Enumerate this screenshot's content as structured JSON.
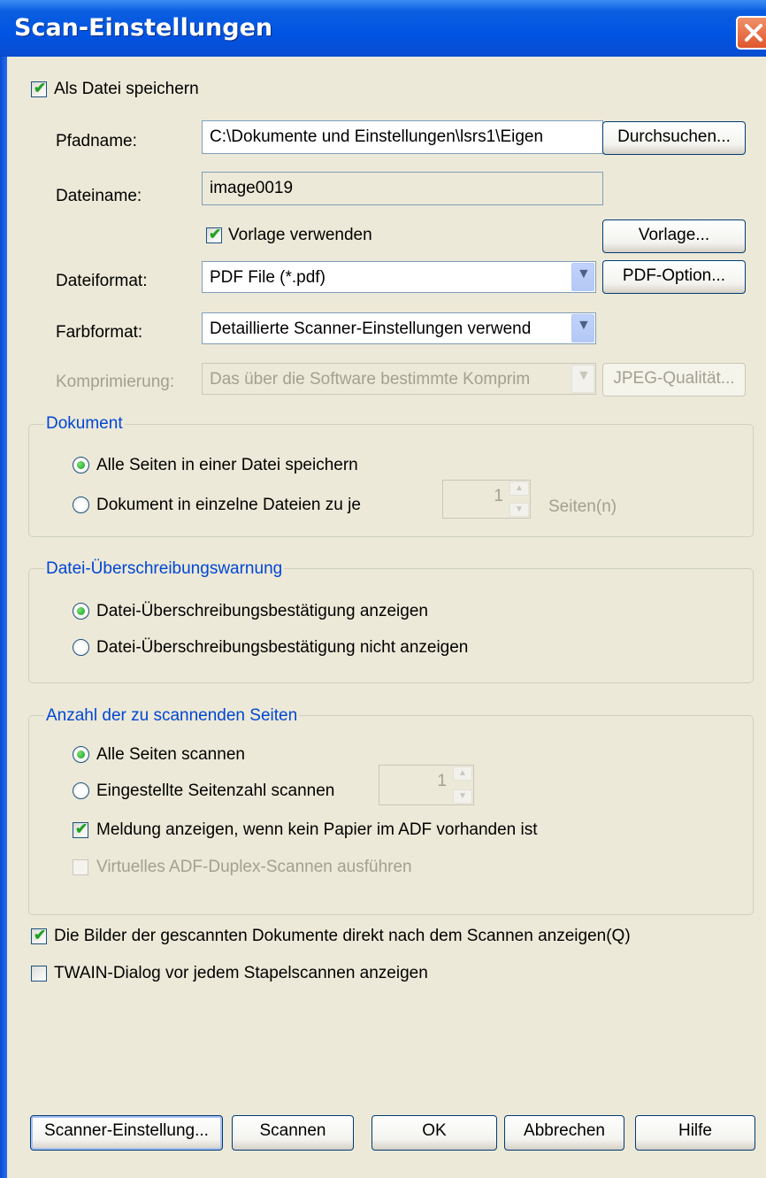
{
  "window": {
    "title": "Scan-Einstellungen",
    "close_icon": "close-icon",
    "accent": "#0054e3",
    "close_color": "#e0572e"
  },
  "save_as_file": {
    "label": "Als Datei speichern",
    "checked": true
  },
  "path": {
    "label": "Pfadname:",
    "value": "C:\\Dokumente und Einstellungen\\lsrs1\\Eigen",
    "browse_label": "Durchsuchen..."
  },
  "filename": {
    "label": "Dateiname:",
    "value": "image0019"
  },
  "template": {
    "label": "Vorlage  verwenden",
    "checked": true,
    "button_label": "Vorlage..."
  },
  "file_format": {
    "label": "Dateiformat:",
    "value": "PDF File (*.pdf)",
    "options_button": "PDF-Option..."
  },
  "color_format": {
    "label": "Farbformat:",
    "value": "Detaillierte Scanner-Einstellungen verwend"
  },
  "compression": {
    "label": "Komprimierung:",
    "value": "Das über die Software bestimmte Komprim",
    "quality_button": "JPEG-Qualität..."
  },
  "document": {
    "title": "Dokument",
    "all_pages_label": "Alle Seiten in einer Datei speichern",
    "split_label": "Dokument in einzelne Dateien zu je",
    "split_value": "1",
    "pages_unit": "Seiten(n)",
    "selected": "all_pages"
  },
  "overwrite": {
    "title": "Datei-Überschreibungswarnung",
    "show_label": "Datei-Überschreibungsbestätigung anzeigen",
    "hide_label": "Datei-Überschreibungsbestätigung nicht anzeigen",
    "selected": "show"
  },
  "page_count": {
    "title": "Anzahl der zu scannenden Seiten",
    "all_label": "Alle Seiten scannen",
    "set_label": "Eingestellte Seitenzahl scannen",
    "set_value": "1",
    "selected": "all",
    "no_paper_label": "Meldung anzeigen, wenn kein Papier im ADF vorhanden ist",
    "no_paper_checked": true,
    "virtual_duplex_label": "Virtuelles ADF-Duplex-Scannen ausführen",
    "virtual_duplex_checked": false
  },
  "show_images": {
    "label": "Die Bilder der gescannten Dokumente direkt nach dem Scannen anzeigen(Q)",
    "checked": true
  },
  "twain_dialog": {
    "label": "TWAIN-Dialog vor jedem Stapelscannen anzeigen",
    "checked": false
  },
  "buttons": {
    "scanner_settings": "Scanner-Einstellung...",
    "scan": "Scannen",
    "ok": "OK",
    "cancel": "Abbrechen",
    "help": "Hilfe"
  }
}
